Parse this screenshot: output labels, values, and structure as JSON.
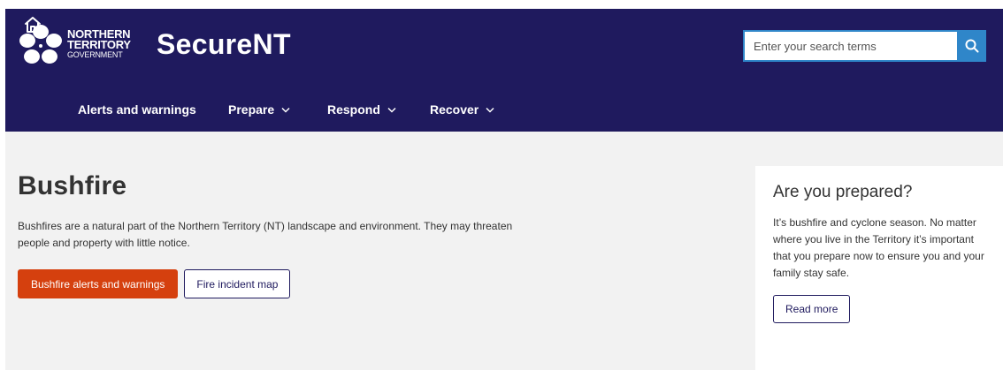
{
  "header": {
    "logo_line1": "NORTHERN",
    "logo_line2": "TERRITORY",
    "logo_line3": "GOVERNMENT",
    "site_title": "SecureNT"
  },
  "search": {
    "placeholder": "Enter your search terms",
    "button_icon": "search-icon"
  },
  "nav": {
    "home_icon": "home-icon",
    "items": [
      {
        "label": "Alerts and warnings",
        "has_dropdown": false
      },
      {
        "label": "Prepare",
        "has_dropdown": true
      },
      {
        "label": "Respond",
        "has_dropdown": true
      },
      {
        "label": "Recover",
        "has_dropdown": true
      }
    ]
  },
  "main": {
    "title": "Bushfire",
    "intro": "Bushfires are a natural part of the Northern Territory (NT) landscape and environment. They may threaten people and property with little notice.",
    "primary_button": "Bushfire alerts and warnings",
    "secondary_button": "Fire incident map"
  },
  "aside": {
    "title": "Are you prepared?",
    "text": "It’s bushfire and cyclone season. No matter where you live in the Territory it’s important that you prepare now to ensure you and your family stay safe.",
    "button": "Read more"
  },
  "colors": {
    "header_bg": "#1f1a5e",
    "search_accent": "#2f86c9",
    "primary_button": "#d5400e",
    "page_bg": "#f2f2f2"
  }
}
